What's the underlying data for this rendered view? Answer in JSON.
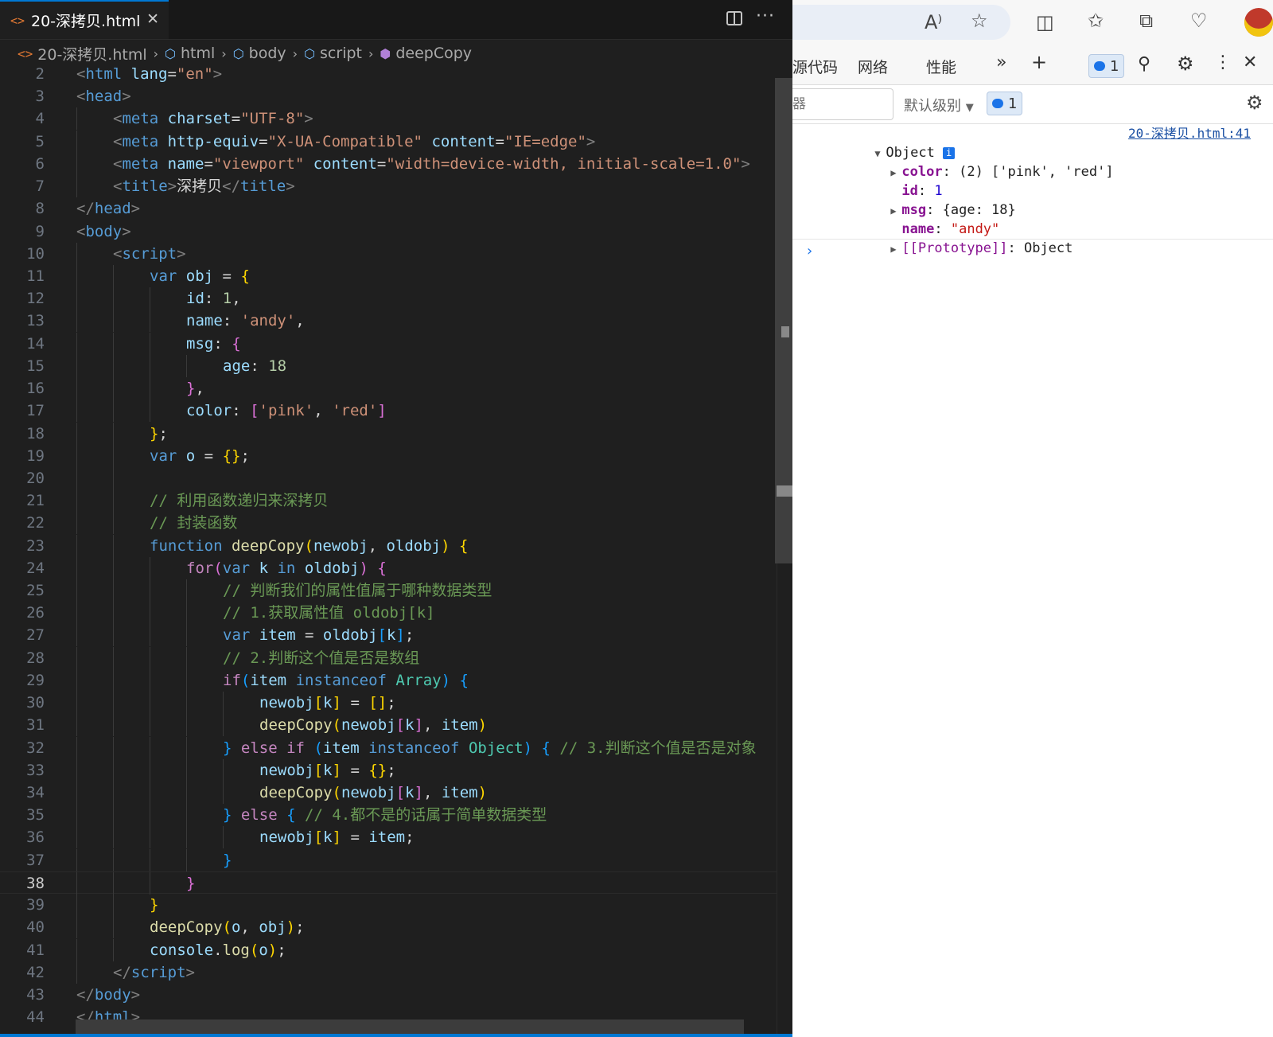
{
  "editor": {
    "tab": {
      "icon": "<>",
      "title": "20-深拷贝.html",
      "close": "✕"
    },
    "more": "···",
    "breadcrumb": [
      "20-深拷贝.html",
      "html",
      "body",
      "script",
      "deepCopy"
    ],
    "active_line": 38,
    "lines": [
      {
        "n": 2,
        "indent": 0,
        "tokens": [
          [
            "t",
            "<"
          ],
          [
            "tg",
            "html"
          ],
          [
            "p",
            " "
          ],
          [
            "at",
            "lang"
          ],
          [
            "p",
            "="
          ],
          [
            "st",
            "\"en\""
          ],
          [
            "t",
            ">"
          ]
        ]
      },
      {
        "n": 3,
        "indent": 0,
        "tokens": [
          [
            "t",
            "<"
          ],
          [
            "tg",
            "head"
          ],
          [
            "t",
            ">"
          ]
        ]
      },
      {
        "n": 4,
        "indent": 1,
        "tokens": [
          [
            "t",
            "<"
          ],
          [
            "tg",
            "meta"
          ],
          [
            "p",
            " "
          ],
          [
            "at",
            "charset"
          ],
          [
            "p",
            "="
          ],
          [
            "st",
            "\"UTF-8\""
          ],
          [
            "t",
            ">"
          ]
        ]
      },
      {
        "n": 5,
        "indent": 1,
        "tokens": [
          [
            "t",
            "<"
          ],
          [
            "tg",
            "meta"
          ],
          [
            "p",
            " "
          ],
          [
            "at",
            "http-equiv"
          ],
          [
            "p",
            "="
          ],
          [
            "st",
            "\"X-UA-Compatible\""
          ],
          [
            "p",
            " "
          ],
          [
            "at",
            "content"
          ],
          [
            "p",
            "="
          ],
          [
            "st",
            "\"IE=edge\""
          ],
          [
            "t",
            ">"
          ]
        ]
      },
      {
        "n": 6,
        "indent": 1,
        "tokens": [
          [
            "t",
            "<"
          ],
          [
            "tg",
            "meta"
          ],
          [
            "p",
            " "
          ],
          [
            "at",
            "name"
          ],
          [
            "p",
            "="
          ],
          [
            "st",
            "\"viewport\""
          ],
          [
            "p",
            " "
          ],
          [
            "at",
            "content"
          ],
          [
            "p",
            "="
          ],
          [
            "st",
            "\"width=device-width, initial-scale=1.0\""
          ],
          [
            "t",
            ">"
          ]
        ]
      },
      {
        "n": 7,
        "indent": 1,
        "tokens": [
          [
            "t",
            "<"
          ],
          [
            "tg",
            "title"
          ],
          [
            "t",
            ">"
          ],
          [
            "p",
            "深拷贝"
          ],
          [
            "t",
            "</"
          ],
          [
            "tg",
            "title"
          ],
          [
            "t",
            ">"
          ]
        ]
      },
      {
        "n": 8,
        "indent": 0,
        "tokens": [
          [
            "t",
            "</"
          ],
          [
            "tg",
            "head"
          ],
          [
            "t",
            ">"
          ]
        ]
      },
      {
        "n": 9,
        "indent": 0,
        "tokens": [
          [
            "t",
            "<"
          ],
          [
            "tg",
            "body"
          ],
          [
            "t",
            ">"
          ]
        ]
      },
      {
        "n": 10,
        "indent": 1,
        "tokens": [
          [
            "t",
            "<"
          ],
          [
            "tg",
            "script"
          ],
          [
            "t",
            ">"
          ]
        ]
      },
      {
        "n": 11,
        "indent": 2,
        "tokens": [
          [
            "kw",
            "var"
          ],
          [
            "p",
            " "
          ],
          [
            "v",
            "obj"
          ],
          [
            "p",
            " = "
          ],
          [
            "b1",
            "{"
          ]
        ]
      },
      {
        "n": 12,
        "indent": 3,
        "tokens": [
          [
            "v",
            "id"
          ],
          [
            "p",
            ": "
          ],
          [
            "n",
            "1"
          ],
          [
            "p",
            ","
          ]
        ]
      },
      {
        "n": 13,
        "indent": 3,
        "tokens": [
          [
            "v",
            "name"
          ],
          [
            "p",
            ": "
          ],
          [
            "st",
            "'andy'"
          ],
          [
            "p",
            ","
          ]
        ]
      },
      {
        "n": 14,
        "indent": 3,
        "tokens": [
          [
            "v",
            "msg"
          ],
          [
            "p",
            ": "
          ],
          [
            "b2",
            "{"
          ]
        ]
      },
      {
        "n": 15,
        "indent": 4,
        "tokens": [
          [
            "v",
            "age"
          ],
          [
            "p",
            ": "
          ],
          [
            "n",
            "18"
          ]
        ]
      },
      {
        "n": 16,
        "indent": 3,
        "tokens": [
          [
            "b2",
            "}"
          ],
          [
            "p",
            ","
          ]
        ]
      },
      {
        "n": 17,
        "indent": 3,
        "tokens": [
          [
            "v",
            "color"
          ],
          [
            "p",
            ": "
          ],
          [
            "b2",
            "["
          ],
          [
            "st",
            "'pink'"
          ],
          [
            "p",
            ", "
          ],
          [
            "st",
            "'red'"
          ],
          [
            "b2",
            "]"
          ]
        ]
      },
      {
        "n": 18,
        "indent": 2,
        "tokens": [
          [
            "b1",
            "}"
          ],
          [
            "p",
            ";"
          ]
        ]
      },
      {
        "n": 19,
        "indent": 2,
        "tokens": [
          [
            "kw",
            "var"
          ],
          [
            "p",
            " "
          ],
          [
            "v",
            "o"
          ],
          [
            "p",
            " = "
          ],
          [
            "b1",
            "{}"
          ],
          [
            "p",
            ";"
          ]
        ]
      },
      {
        "n": 20,
        "indent": 2,
        "tokens": []
      },
      {
        "n": 21,
        "indent": 2,
        "tokens": [
          [
            "cm",
            "// 利用函数递归来深拷贝"
          ]
        ]
      },
      {
        "n": 22,
        "indent": 2,
        "tokens": [
          [
            "cm",
            "// 封装函数"
          ]
        ]
      },
      {
        "n": 23,
        "indent": 2,
        "tokens": [
          [
            "kw",
            "function"
          ],
          [
            "p",
            " "
          ],
          [
            "fn",
            "deepCopy"
          ],
          [
            "b1",
            "("
          ],
          [
            "v",
            "newobj"
          ],
          [
            "p",
            ", "
          ],
          [
            "v",
            "oldobj"
          ],
          [
            "b1",
            ")"
          ],
          [
            "p",
            " "
          ],
          [
            "b1",
            "{"
          ]
        ]
      },
      {
        "n": 24,
        "indent": 3,
        "tokens": [
          [
            "cf",
            "for"
          ],
          [
            "b2",
            "("
          ],
          [
            "kw",
            "var"
          ],
          [
            "p",
            " "
          ],
          [
            "v",
            "k"
          ],
          [
            "p",
            " "
          ],
          [
            "kw",
            "in"
          ],
          [
            "p",
            " "
          ],
          [
            "v",
            "oldobj"
          ],
          [
            "b2",
            ")"
          ],
          [
            "p",
            " "
          ],
          [
            "b2",
            "{"
          ]
        ]
      },
      {
        "n": 25,
        "indent": 4,
        "tokens": [
          [
            "cm",
            "// 判断我们的属性值属于哪种数据类型"
          ]
        ]
      },
      {
        "n": 26,
        "indent": 4,
        "tokens": [
          [
            "cm",
            "// 1.获取属性值 oldobj[k]"
          ]
        ]
      },
      {
        "n": 27,
        "indent": 4,
        "tokens": [
          [
            "kw",
            "var"
          ],
          [
            "p",
            " "
          ],
          [
            "v",
            "item"
          ],
          [
            "p",
            " = "
          ],
          [
            "v",
            "oldobj"
          ],
          [
            "b3",
            "["
          ],
          [
            "v",
            "k"
          ],
          [
            "b3",
            "]"
          ],
          [
            "p",
            ";"
          ]
        ]
      },
      {
        "n": 28,
        "indent": 4,
        "tokens": [
          [
            "cm",
            "// 2.判断这个值是否是数组"
          ]
        ]
      },
      {
        "n": 29,
        "indent": 4,
        "tokens": [
          [
            "cf",
            "if"
          ],
          [
            "b3",
            "("
          ],
          [
            "v",
            "item"
          ],
          [
            "p",
            " "
          ],
          [
            "kw",
            "instanceof"
          ],
          [
            "p",
            " "
          ],
          [
            "ty",
            "Array"
          ],
          [
            "b3",
            ")"
          ],
          [
            "p",
            " "
          ],
          [
            "b3",
            "{"
          ]
        ]
      },
      {
        "n": 30,
        "indent": 5,
        "tokens": [
          [
            "v",
            "newobj"
          ],
          [
            "b1",
            "["
          ],
          [
            "v",
            "k"
          ],
          [
            "b1",
            "]"
          ],
          [
            "p",
            " = "
          ],
          [
            "b1",
            "[]"
          ],
          [
            "p",
            ";"
          ]
        ]
      },
      {
        "n": 31,
        "indent": 5,
        "tokens": [
          [
            "fn",
            "deepCopy"
          ],
          [
            "b1",
            "("
          ],
          [
            "v",
            "newobj"
          ],
          [
            "b2",
            "["
          ],
          [
            "v",
            "k"
          ],
          [
            "b2",
            "]"
          ],
          [
            "p",
            ", "
          ],
          [
            "v",
            "item"
          ],
          [
            "b1",
            ")"
          ]
        ]
      },
      {
        "n": 32,
        "indent": 4,
        "tokens": [
          [
            "b3",
            "}"
          ],
          [
            "p",
            " "
          ],
          [
            "cf",
            "else if"
          ],
          [
            "p",
            " "
          ],
          [
            "b3",
            "("
          ],
          [
            "v",
            "item"
          ],
          [
            "p",
            " "
          ],
          [
            "kw",
            "instanceof"
          ],
          [
            "p",
            " "
          ],
          [
            "ty",
            "Object"
          ],
          [
            "b3",
            ")"
          ],
          [
            "p",
            " "
          ],
          [
            "b3",
            "{"
          ],
          [
            "p",
            " "
          ],
          [
            "cm",
            "// 3.判断这个值是否是对象"
          ]
        ]
      },
      {
        "n": 33,
        "indent": 5,
        "tokens": [
          [
            "v",
            "newobj"
          ],
          [
            "b1",
            "["
          ],
          [
            "v",
            "k"
          ],
          [
            "b1",
            "]"
          ],
          [
            "p",
            " = "
          ],
          [
            "b1",
            "{}"
          ],
          [
            "p",
            ";"
          ]
        ]
      },
      {
        "n": 34,
        "indent": 5,
        "tokens": [
          [
            "fn",
            "deepCopy"
          ],
          [
            "b1",
            "("
          ],
          [
            "v",
            "newobj"
          ],
          [
            "b2",
            "["
          ],
          [
            "v",
            "k"
          ],
          [
            "b2",
            "]"
          ],
          [
            "p",
            ", "
          ],
          [
            "v",
            "item"
          ],
          [
            "b1",
            ")"
          ]
        ]
      },
      {
        "n": 35,
        "indent": 4,
        "tokens": [
          [
            "b3",
            "}"
          ],
          [
            "p",
            " "
          ],
          [
            "cf",
            "else"
          ],
          [
            "p",
            " "
          ],
          [
            "b3",
            "{"
          ],
          [
            "p",
            " "
          ],
          [
            "cm",
            "// 4.都不是的话属于简单数据类型"
          ]
        ]
      },
      {
        "n": 36,
        "indent": 5,
        "tokens": [
          [
            "v",
            "newobj"
          ],
          [
            "b1",
            "["
          ],
          [
            "v",
            "k"
          ],
          [
            "b1",
            "]"
          ],
          [
            "p",
            " = "
          ],
          [
            "v",
            "item"
          ],
          [
            "p",
            ";"
          ]
        ]
      },
      {
        "n": 37,
        "indent": 4,
        "tokens": [
          [
            "b3",
            "}"
          ]
        ]
      },
      {
        "n": 38,
        "indent": 3,
        "tokens": [
          [
            "b2",
            "}"
          ]
        ]
      },
      {
        "n": 39,
        "indent": 2,
        "tokens": [
          [
            "b1",
            "}"
          ]
        ]
      },
      {
        "n": 40,
        "indent": 2,
        "tokens": [
          [
            "fn",
            "deepCopy"
          ],
          [
            "b1",
            "("
          ],
          [
            "v",
            "o"
          ],
          [
            "p",
            ", "
          ],
          [
            "v",
            "obj"
          ],
          [
            "b1",
            ")"
          ],
          [
            "p",
            ";"
          ]
        ]
      },
      {
        "n": 41,
        "indent": 2,
        "tokens": [
          [
            "v",
            "console"
          ],
          [
            "p",
            "."
          ],
          [
            "fn",
            "log"
          ],
          [
            "b1",
            "("
          ],
          [
            "v",
            "o"
          ],
          [
            "b1",
            ")"
          ],
          [
            "p",
            ";"
          ]
        ]
      },
      {
        "n": 42,
        "indent": 1,
        "tokens": [
          [
            "t",
            "</"
          ],
          [
            "tg",
            "script"
          ],
          [
            "t",
            ">"
          ]
        ]
      },
      {
        "n": 43,
        "indent": 0,
        "tokens": [
          [
            "t",
            "</"
          ],
          [
            "tg",
            "body"
          ],
          [
            "t",
            ">"
          ]
        ]
      },
      {
        "n": 44,
        "indent": 0,
        "tokens": [
          [
            "t",
            "</"
          ],
          [
            "tg",
            "html"
          ],
          [
            "t",
            ">"
          ]
        ]
      }
    ]
  },
  "devtools": {
    "tabs": [
      "源代码",
      "网络",
      "性能"
    ],
    "issues_count": "1",
    "filter_placeholder": "器",
    "levels_label": "默认级别",
    "console": {
      "header": "Object",
      "source_link": "20-深拷贝.html:41",
      "color_key": "color",
      "color_val": "(2) ['pink', 'red']",
      "id_key": "id",
      "id_val": "1",
      "msg_key": "msg",
      "msg_val": "{age: 18}",
      "name_key": "name",
      "name_val": "\"andy\"",
      "proto_key": "[[Prototype]]",
      "proto_val": "Object"
    }
  },
  "colors": {
    "accent": "#0078d4",
    "editor_bg": "#1f1f1f",
    "console_link": "#1a4fa3"
  },
  "icons": [
    "html-file-icon",
    "close-icon",
    "split-editor-icon",
    "more-icon",
    "symbol-icon",
    "function-icon",
    "read-aloud-icon",
    "favorite-star-icon",
    "split-screen-icon",
    "favorites-icon",
    "collections-icon",
    "health-icon",
    "more-tabs-icon",
    "add-tab-icon",
    "issues-icon",
    "gear-icon",
    "dots-icon",
    "close-devtools-icon",
    "expand-triangle-icon",
    "info-icon",
    "prompt-chevron-icon"
  ]
}
